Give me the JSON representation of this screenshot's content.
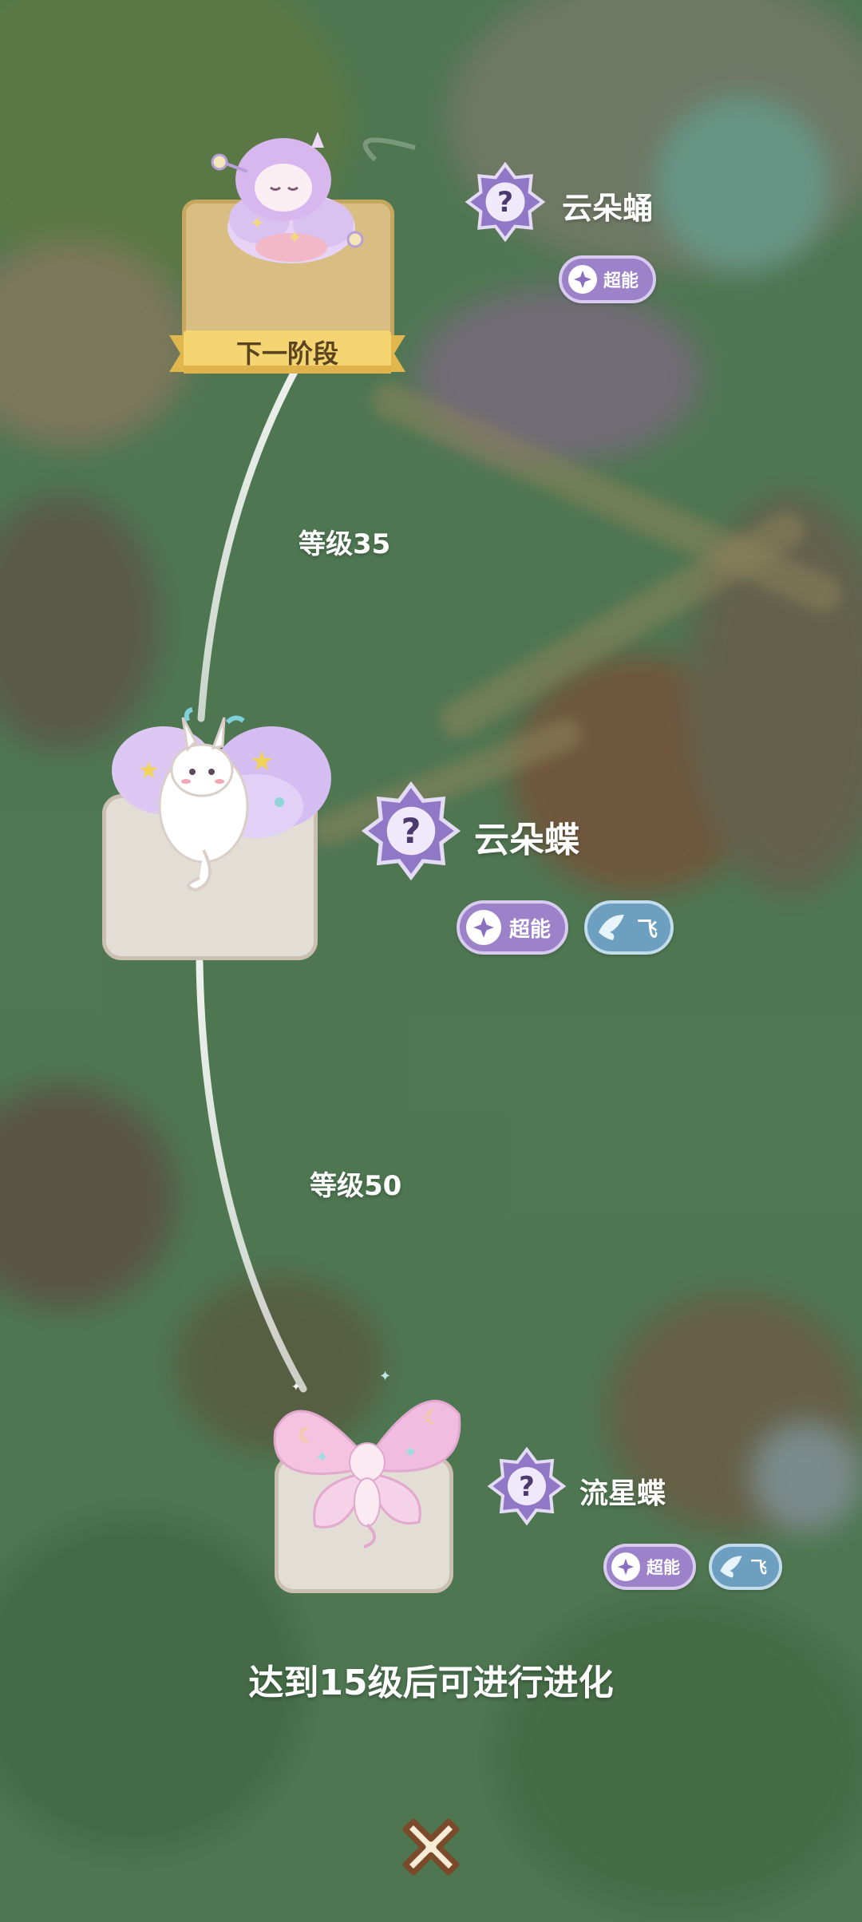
{
  "stages": [
    {
      "id": "cloud-pupa",
      "name": "云朵蛹",
      "label": "下一阶段",
      "traits": [
        {
          "type": "psychic",
          "label": "超能",
          "icon": "psychic-icon"
        }
      ]
    },
    {
      "id": "cloud-butterfly",
      "name": "云朵蝶",
      "requirement": "等级35",
      "traits": [
        {
          "type": "psychic",
          "label": "超能",
          "icon": "psychic-icon"
        },
        {
          "type": "flying",
          "label": "飞",
          "icon": "wing-icon"
        }
      ]
    },
    {
      "id": "meteor-butterfly",
      "name": "流星蝶",
      "requirement": "等级50",
      "traits": [
        {
          "type": "psychic",
          "label": "超能",
          "icon": "psychic-icon"
        },
        {
          "type": "flying",
          "label": "飞",
          "icon": "wing-icon"
        }
      ]
    }
  ],
  "hint": "达到15级后可进行进化",
  "close_icon": "close-icon",
  "colors": {
    "psychic": "#9b82c9",
    "flying": "#6d9fc0",
    "next_card": "#d9be84",
    "card": "#e2ddd5"
  }
}
